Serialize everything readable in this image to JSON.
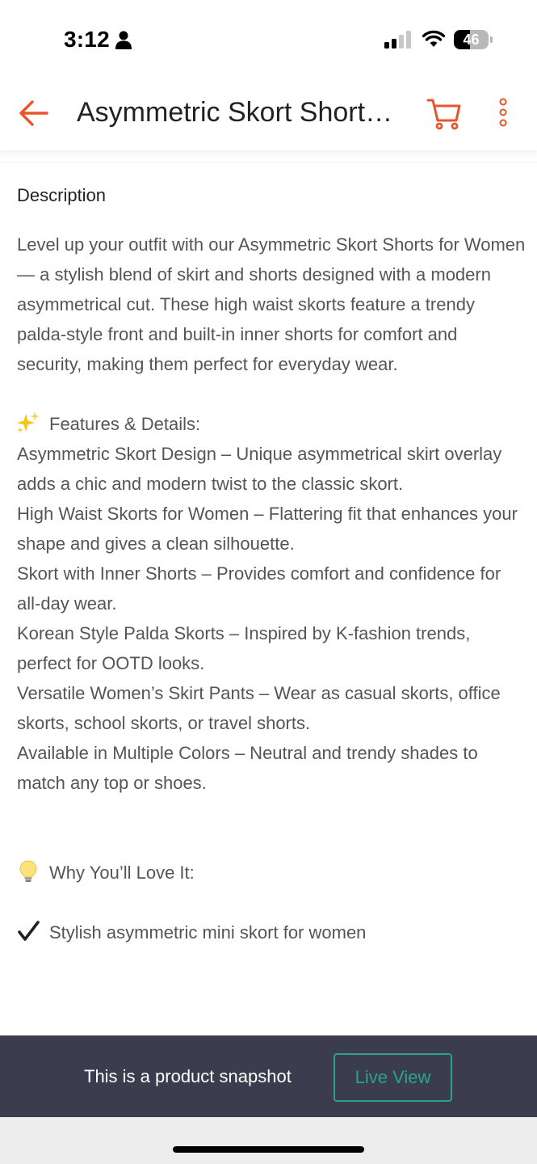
{
  "status_bar": {
    "time": "3:12",
    "battery_percent": 46,
    "battery_label": "46",
    "signal_bars": 2,
    "icons": [
      "person-icon",
      "signal-icon",
      "wifi-icon",
      "battery-icon"
    ]
  },
  "nav": {
    "title": "Asymmetric Skort Shorts for Women",
    "icons": [
      "back-arrow-icon",
      "cart-icon",
      "more-vertical-icon"
    ],
    "accent_color": "#e8542c"
  },
  "description": {
    "heading": "Description",
    "intro": "Level up your outfit with our Asymmetric Skort Shorts for Women — a stylish blend of skirt and shorts designed with a modern asymmetrical cut. These high waist skorts feature a trendy palda-style front and built-in inner shorts for comfort and security, making them perfect for everyday wear.",
    "features_heading": "Features & Details:",
    "features_emoji": "sparkles-icon",
    "features": [
      "Asymmetric Skort Design – Unique asymmetrical skirt overlay adds a chic and modern twist to the classic skort.",
      "High Waist Skorts for Women – Flattering fit that enhances your shape and gives a clean silhouette.",
      "Skort with Inner Shorts – Provides comfort and confidence for all-day wear.",
      "Korean Style Palda Skorts – Inspired by K-fashion trends, perfect for OOTD looks.",
      "Versatile Women’s Skirt Pants – Wear as casual skorts, office skorts, school skorts, or travel shorts.",
      "Available in Multiple Colors – Neutral and trendy shades to match any top or shoes."
    ],
    "why_heading": "Why You’ll Love It:",
    "why_emoji": "lightbulb-icon",
    "why_items": [
      {
        "icon": "checkmark-icon",
        "text": "Stylish asymmetric mini skort for women"
      }
    ]
  },
  "banner": {
    "text": "This is a product snapshot",
    "button_label": "Live View",
    "background_color": "#3b3d4f",
    "button_color": "#27a38e"
  }
}
